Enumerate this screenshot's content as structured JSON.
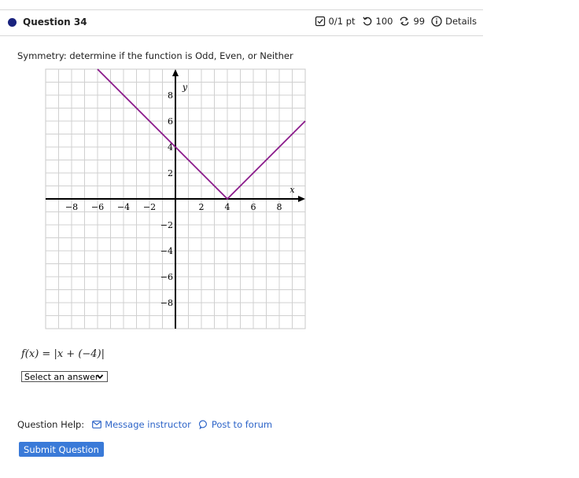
{
  "question": {
    "title": "Question 34"
  },
  "meta": {
    "score": "0/1 pt",
    "retries": "100",
    "attempts": "99",
    "details": "Details"
  },
  "prompt": "Symmetry: determine if the function is Odd, Even, or Neither",
  "chart_data": {
    "type": "line",
    "xlabel": "x",
    "ylabel": "y",
    "xlim": [
      -10,
      10
    ],
    "ylim": [
      -10,
      10
    ],
    "grid": true,
    "x_ticks": [
      -8,
      -6,
      -4,
      -2,
      2,
      4,
      6,
      8
    ],
    "y_ticks": [
      8,
      6,
      4,
      2,
      -2,
      -4,
      -6,
      -8
    ],
    "series": [
      {
        "x": [
          -6,
          4,
          10
        ],
        "y": [
          10,
          0,
          6
        ],
        "color": "#8b1a8b"
      }
    ]
  },
  "function": {
    "lhs": "f(x) = |x + (−4)|"
  },
  "select": {
    "value": "Select an answer"
  },
  "help": {
    "label": "Question Help:",
    "message": "Message instructor",
    "forum": "Post to forum"
  },
  "submit_label": "Submit Question"
}
